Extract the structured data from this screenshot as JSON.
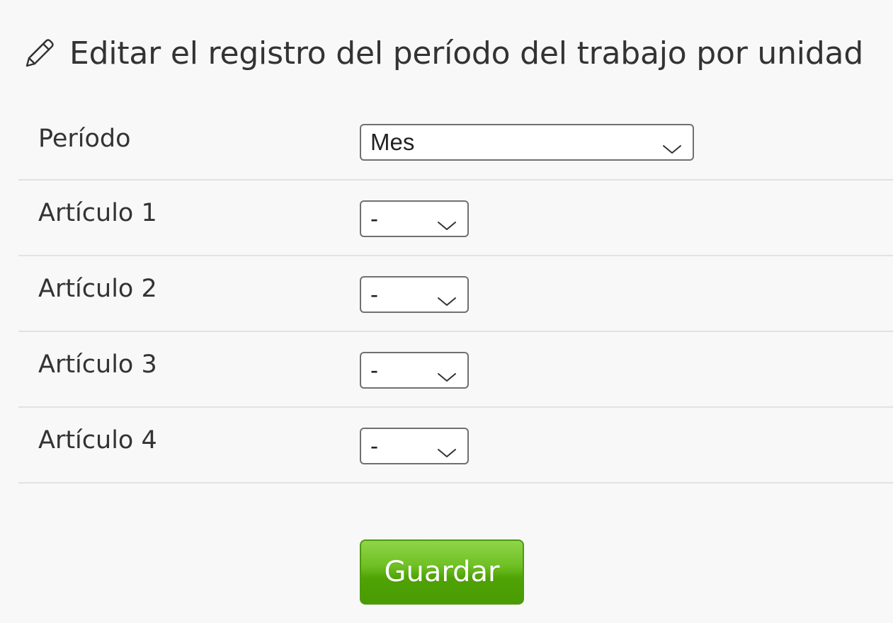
{
  "header": {
    "title": "Editar el registro del período del trabajo por unidad",
    "icon": "pencil-icon"
  },
  "form": {
    "rows": [
      {
        "label": "Período",
        "value": "Mes"
      },
      {
        "label": "Artículo 1",
        "value": "-"
      },
      {
        "label": "Artículo 2",
        "value": "-"
      },
      {
        "label": "Artículo 3",
        "value": "-"
      },
      {
        "label": "Artículo 4",
        "value": "-"
      }
    ]
  },
  "actions": {
    "save_label": "Guardar"
  },
  "colors": {
    "background": "#f8f8f8",
    "text": "#333333",
    "divider": "#e2e2e2",
    "select_border": "#707070",
    "button_green": "#5cb314",
    "button_border": "#4d9a10"
  }
}
